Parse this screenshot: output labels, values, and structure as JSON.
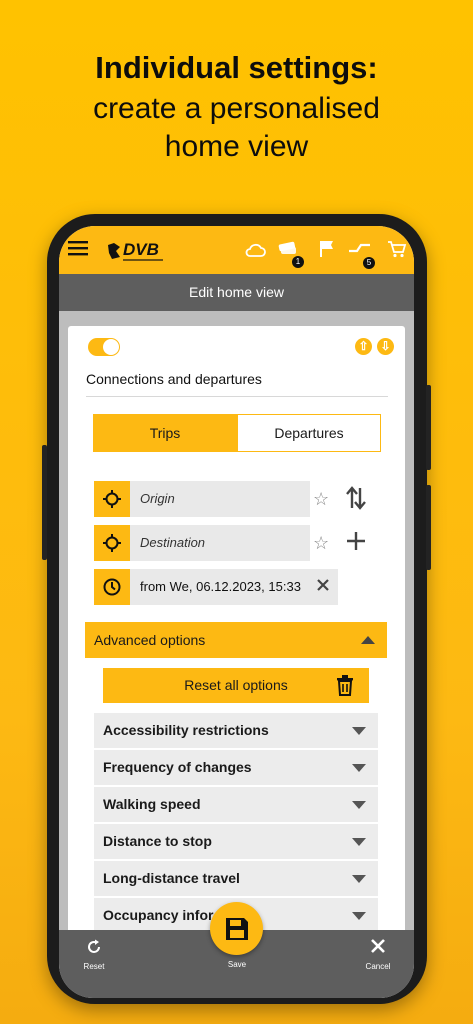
{
  "promo": {
    "headline": "Individual settings:",
    "subline1": "create a personalised",
    "subline2": "home view"
  },
  "appbar": {
    "logo": "DVB",
    "weather_icon": "cloud-icon",
    "tickets_badge": "1",
    "connections_badge": "5"
  },
  "title": "Edit home view",
  "card": {
    "section_title": "Connections and departures",
    "tabs": {
      "trips": "Trips",
      "departures": "Departures"
    },
    "origin_placeholder": "Origin",
    "destination_placeholder": "Destination",
    "datetime": "from We, 06.12.2023, 15:33",
    "advanced_label": "Advanced options",
    "reset_label": "Reset all options",
    "options": [
      "Accessibility restrictions",
      "Frequency of changes",
      "Walking speed",
      "Distance to stop",
      "Long-distance travel",
      "Occupancy infor"
    ]
  },
  "bottom": {
    "reset": "Reset",
    "save": "Save",
    "cancel": "Cancel"
  },
  "colors": {
    "brand_yellow": "#FDB913",
    "bar_gray": "#5E5E5E"
  }
}
